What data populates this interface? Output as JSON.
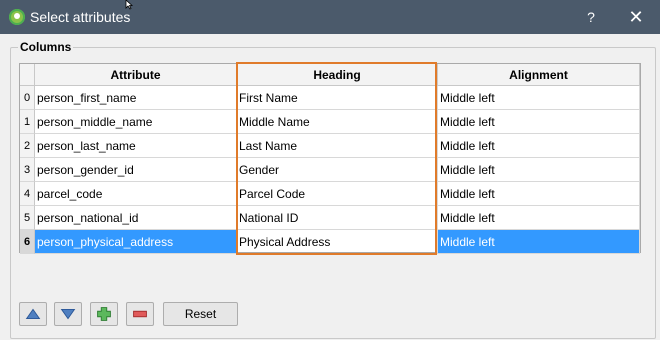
{
  "window": {
    "title": "Select attributes",
    "help": "?",
    "close": "✕"
  },
  "group": {
    "title": "Columns"
  },
  "table": {
    "headers": [
      "Attribute",
      "Heading",
      "Alignment"
    ],
    "rows": [
      {
        "index": "0",
        "attribute": "person_first_name",
        "heading": "First Name",
        "alignment": "Middle left"
      },
      {
        "index": "1",
        "attribute": "person_middle_name",
        "heading": "Middle Name",
        "alignment": "Middle left"
      },
      {
        "index": "2",
        "attribute": "person_last_name",
        "heading": "Last Name",
        "alignment": "Middle left"
      },
      {
        "index": "3",
        "attribute": "person_gender_id",
        "heading": "Gender",
        "alignment": "Middle left"
      },
      {
        "index": "4",
        "attribute": "parcel_code",
        "heading": "Parcel Code",
        "alignment": "Middle left"
      },
      {
        "index": "5",
        "attribute": "person_national_id",
        "heading": "National ID",
        "alignment": "Middle left"
      },
      {
        "index": "6",
        "attribute": "person_physical_address",
        "heading": "Physical Address",
        "alignment": "Middle left"
      }
    ],
    "selected_row": 6
  },
  "buttons": {
    "up_icon": "arrow-up-icon",
    "down_icon": "arrow-down-icon",
    "add_icon": "plus-icon",
    "remove_icon": "minus-icon",
    "reset": "Reset"
  },
  "colors": {
    "selection": "#3399ff",
    "highlight": "#e07b2a",
    "titlebar": "#4b5a6b"
  }
}
